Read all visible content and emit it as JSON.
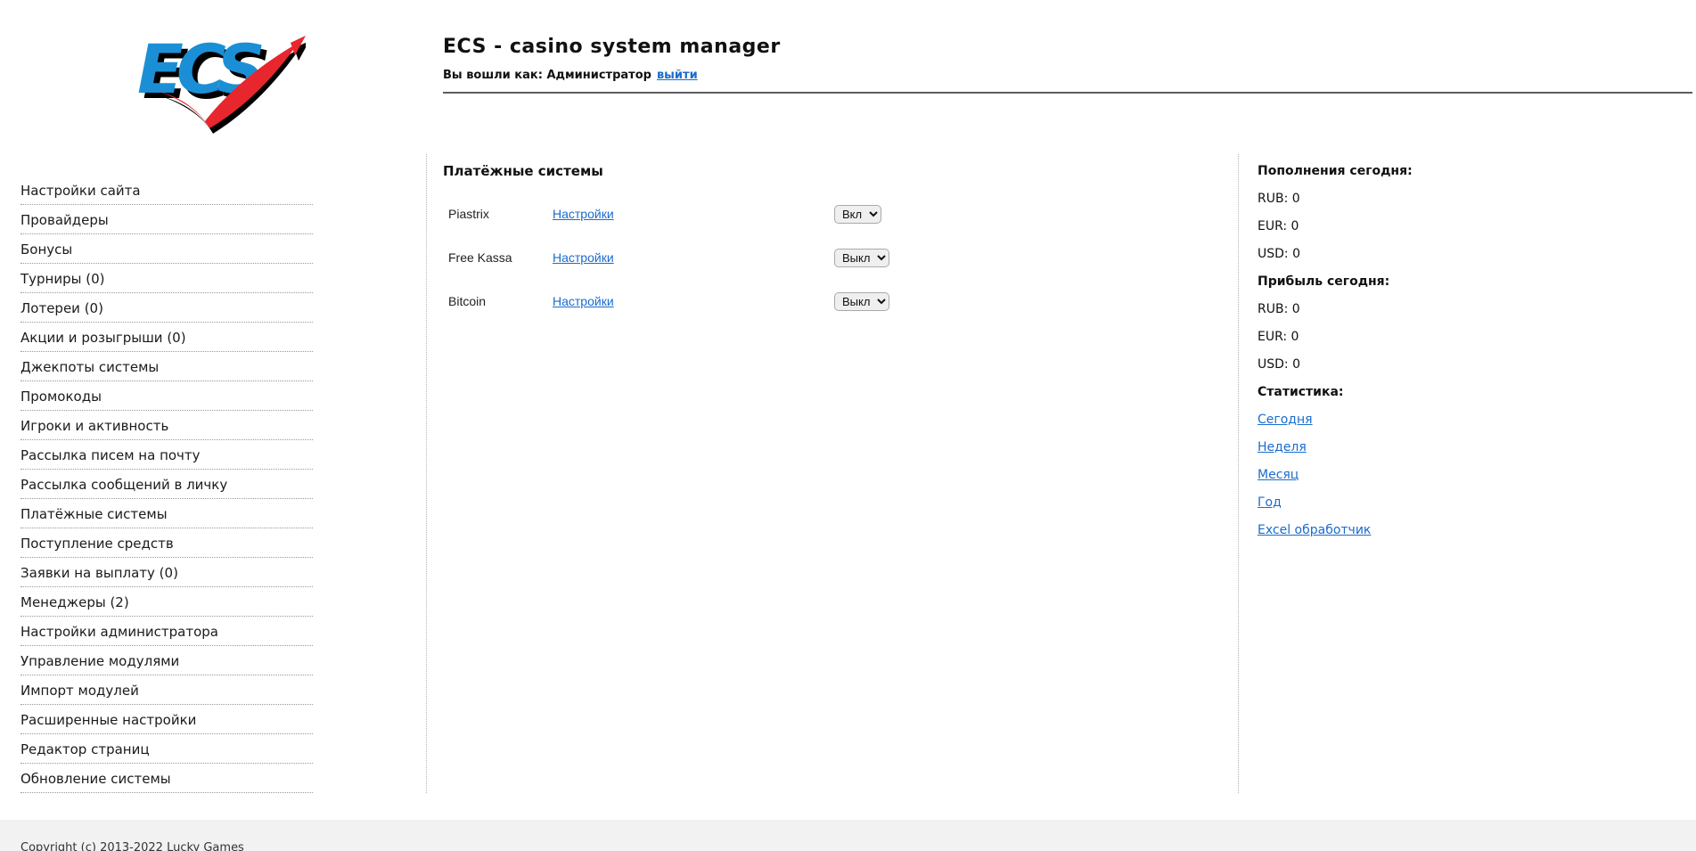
{
  "header": {
    "logo_text": "ECS",
    "title": "ECS - casino system manager",
    "login_prefix": "Вы вошли как: Администратор",
    "logout_link": "выйти"
  },
  "sidebar": {
    "items": [
      "Настройки сайта",
      "Провайдеры",
      "Бонусы",
      "Турниры (0)",
      "Лотереи (0)",
      "Акции и розыгрыши (0)",
      "Джекпоты системы",
      "Промокоды",
      "Игроки и активность",
      "Рассылка писем на почту",
      "Рассылка сообщений в личку",
      "Платёжные системы",
      "Поступление средств",
      "Заявки на выплату (0)",
      "Менеджеры (2)",
      "Настройки администратора",
      "Управление модулями",
      "Импорт модулей",
      "Расширенные настройки",
      "Редактор страниц",
      "Обновление системы"
    ]
  },
  "main": {
    "heading": "Платёжные системы",
    "rows": [
      {
        "name": "Piastrix",
        "settings": "Настройки",
        "state": "Вкл"
      },
      {
        "name": "Free Kassa",
        "settings": "Настройки",
        "state": "Выкл"
      },
      {
        "name": "Bitcoin",
        "settings": "Настройки",
        "state": "Выкл"
      }
    ]
  },
  "stats_panel": {
    "sections": [
      {
        "heading": "Пополнения сегодня:",
        "lines": [
          "RUB: 0",
          "EUR: 0",
          "USD: 0"
        ]
      },
      {
        "heading": "Прибыль сегодня:",
        "lines": [
          "RUB: 0",
          "EUR: 0",
          "USD: 0"
        ]
      },
      {
        "heading": "Статистика:",
        "links": [
          "Сегодня",
          "Неделя",
          "Месяц",
          "Год",
          "Excel обработчик"
        ]
      }
    ]
  },
  "footer": {
    "copyright": "Copyright (c) 2013-2022 Lucky Games"
  },
  "colors": {
    "link_blue": "#1a6ccd",
    "logo_blue": "#1b8fd6",
    "logo_red": "#e8262d",
    "header_rule_gray": "#5c5c5c",
    "footer_gray": "#f2f2f2"
  }
}
